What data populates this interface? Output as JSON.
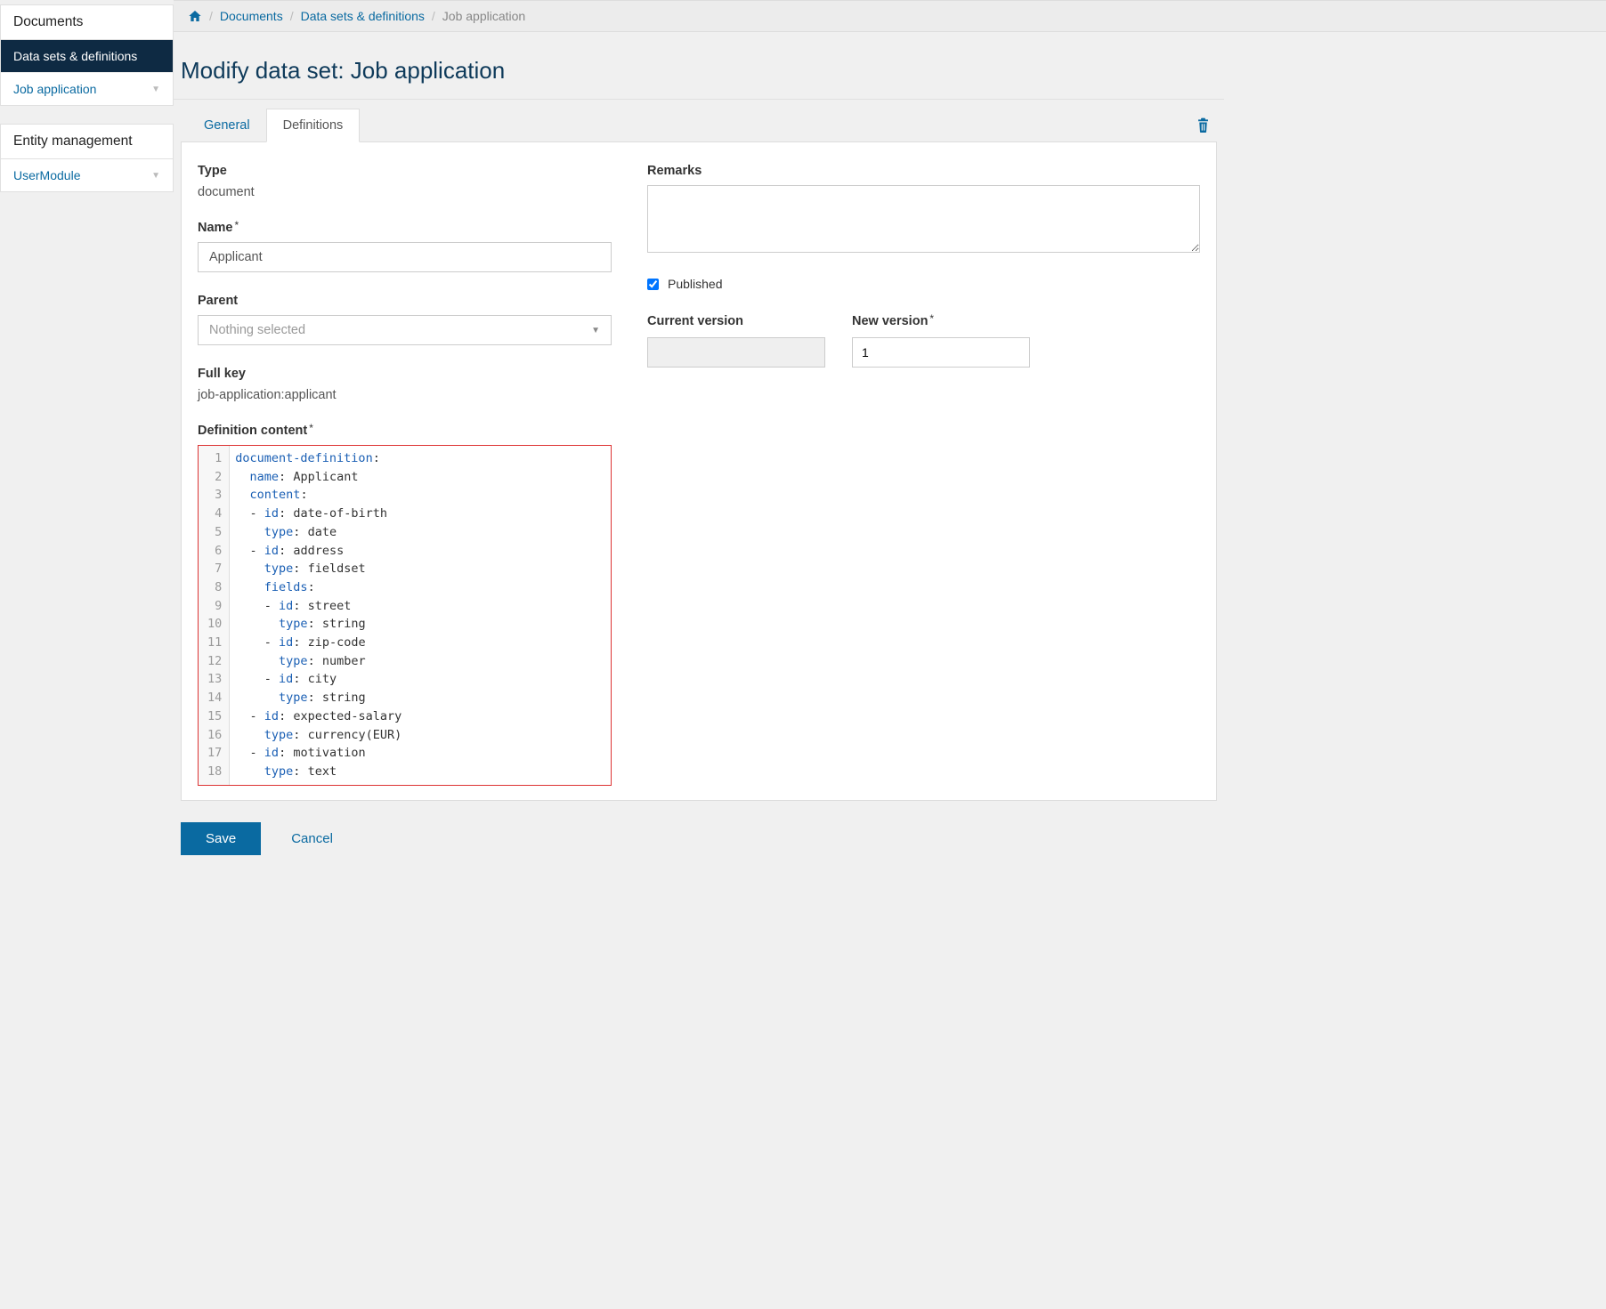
{
  "sidebar": {
    "documents_header": "Documents",
    "documents_items": [
      {
        "label": "Data sets & definitions",
        "active": true
      },
      {
        "label": "Job application",
        "caret": true
      }
    ],
    "entity_header": "Entity management",
    "entity_items": [
      {
        "label": "UserModule",
        "caret": true
      }
    ]
  },
  "breadcrumb": {
    "home": "Home",
    "items": [
      {
        "label": "Documents",
        "link": true
      },
      {
        "label": "Data sets & definitions",
        "link": true
      },
      {
        "label": "Job application",
        "link": false
      }
    ]
  },
  "page_title": "Modify data set: Job application",
  "tabs": {
    "general": "General",
    "definitions": "Definitions"
  },
  "form": {
    "type_label": "Type",
    "type_value": "document",
    "name_label": "Name",
    "name_value": "Applicant",
    "parent_label": "Parent",
    "parent_placeholder": "Nothing selected",
    "fullkey_label": "Full key",
    "fullkey_value": "job-application:applicant",
    "defcontent_label": "Definition content",
    "remarks_label": "Remarks",
    "remarks_value": "",
    "published_label": "Published",
    "published_checked": true,
    "current_version_label": "Current version",
    "current_version_value": "",
    "new_version_label": "New version",
    "new_version_value": "1"
  },
  "editor_lines": [
    [
      [
        "kw",
        "document-definition"
      ],
      [
        "punct",
        ":"
      ]
    ],
    [
      [
        "str",
        "  "
      ],
      [
        "kw",
        "name"
      ],
      [
        "punct",
        ": "
      ],
      [
        "str",
        "Applicant"
      ]
    ],
    [
      [
        "str",
        "  "
      ],
      [
        "kw",
        "content"
      ],
      [
        "punct",
        ":"
      ]
    ],
    [
      [
        "str",
        "  "
      ],
      [
        "punct",
        "- "
      ],
      [
        "kw",
        "id"
      ],
      [
        "punct",
        ": "
      ],
      [
        "str",
        "date-of-birth"
      ]
    ],
    [
      [
        "str",
        "    "
      ],
      [
        "kw",
        "type"
      ],
      [
        "punct",
        ": "
      ],
      [
        "str",
        "date"
      ]
    ],
    [
      [
        "str",
        "  "
      ],
      [
        "punct",
        "- "
      ],
      [
        "kw",
        "id"
      ],
      [
        "punct",
        ": "
      ],
      [
        "str",
        "address"
      ]
    ],
    [
      [
        "str",
        "    "
      ],
      [
        "kw",
        "type"
      ],
      [
        "punct",
        ": "
      ],
      [
        "str",
        "fieldset"
      ]
    ],
    [
      [
        "str",
        "    "
      ],
      [
        "kw",
        "fields"
      ],
      [
        "punct",
        ":"
      ]
    ],
    [
      [
        "str",
        "    "
      ],
      [
        "punct",
        "- "
      ],
      [
        "kw",
        "id"
      ],
      [
        "punct",
        ": "
      ],
      [
        "str",
        "street"
      ]
    ],
    [
      [
        "str",
        "      "
      ],
      [
        "kw",
        "type"
      ],
      [
        "punct",
        ": "
      ],
      [
        "str",
        "string"
      ]
    ],
    [
      [
        "str",
        "    "
      ],
      [
        "punct",
        "- "
      ],
      [
        "kw",
        "id"
      ],
      [
        "punct",
        ": "
      ],
      [
        "str",
        "zip-code"
      ]
    ],
    [
      [
        "str",
        "      "
      ],
      [
        "kw",
        "type"
      ],
      [
        "punct",
        ": "
      ],
      [
        "str",
        "number"
      ]
    ],
    [
      [
        "str",
        "    "
      ],
      [
        "punct",
        "- "
      ],
      [
        "kw",
        "id"
      ],
      [
        "punct",
        ": "
      ],
      [
        "str",
        "city"
      ]
    ],
    [
      [
        "str",
        "      "
      ],
      [
        "kw",
        "type"
      ],
      [
        "punct",
        ": "
      ],
      [
        "str",
        "string"
      ]
    ],
    [
      [
        "str",
        "  "
      ],
      [
        "punct",
        "- "
      ],
      [
        "kw",
        "id"
      ],
      [
        "punct",
        ": "
      ],
      [
        "str",
        "expected-salary"
      ]
    ],
    [
      [
        "str",
        "    "
      ],
      [
        "kw",
        "type"
      ],
      [
        "punct",
        ": "
      ],
      [
        "str",
        "currency(EUR)"
      ]
    ],
    [
      [
        "str",
        "  "
      ],
      [
        "punct",
        "- "
      ],
      [
        "kw",
        "id"
      ],
      [
        "punct",
        ": "
      ],
      [
        "str",
        "motivation"
      ]
    ],
    [
      [
        "str",
        "    "
      ],
      [
        "kw",
        "type"
      ],
      [
        "punct",
        ": "
      ],
      [
        "str",
        "text"
      ]
    ]
  ],
  "buttons": {
    "save": "Save",
    "cancel": "Cancel"
  }
}
